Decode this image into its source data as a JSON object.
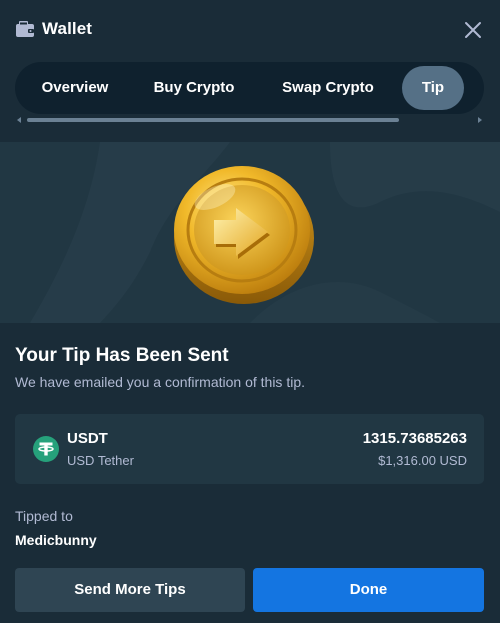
{
  "header": {
    "title": "Wallet",
    "icons": {
      "wallet": "wallet-icon",
      "close": "close-icon"
    }
  },
  "tabs": [
    {
      "label": "Overview",
      "active": false
    },
    {
      "label": "Buy Crypto",
      "active": false
    },
    {
      "label": "Swap Crypto",
      "active": false
    },
    {
      "label": "Tip",
      "active": true
    }
  ],
  "hero": {
    "image": "gold-coin-arrow-illustration"
  },
  "confirmation": {
    "headline": "Your Tip Has Been Sent",
    "message": "We have emailed you a confirmation of this tip."
  },
  "asset": {
    "icon": "tether-icon",
    "symbol": "USDT",
    "name": "USD Tether",
    "amount": "1315.73685263",
    "usd_value": "$1,316.00 USD"
  },
  "recipient": {
    "label": "Tipped to",
    "username": "Medicbunny"
  },
  "actions": {
    "send_more_label": "Send More Tips",
    "done_label": "Done"
  },
  "colors": {
    "background": "#1a2c38",
    "card": "#213743",
    "tab_bar": "#0f212e",
    "tab_active": "#557086",
    "primary": "#1475e1",
    "secondary": "#2f4553",
    "muted_text": "#b1bad3",
    "tether": "#26a17b"
  }
}
